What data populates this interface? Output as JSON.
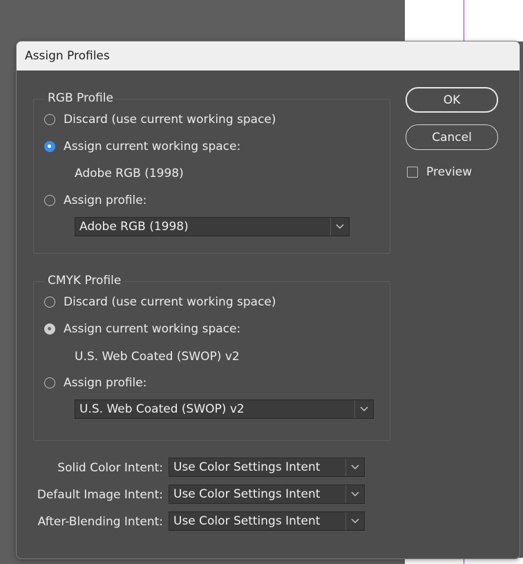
{
  "dialog": {
    "title": "Assign Profiles",
    "ok_label": "OK",
    "cancel_label": "Cancel",
    "preview_label": "Preview",
    "preview_checked": false
  },
  "rgb": {
    "legend": "RGB Profile",
    "discard_label": "Discard (use current working space)",
    "assign_current_label": "Assign current working space:",
    "current_space": "Adobe RGB (1998)",
    "assign_profile_label": "Assign profile:",
    "profile_selected": "Adobe RGB (1998)",
    "selected_option": "assign-current"
  },
  "cmyk": {
    "legend": "CMYK Profile",
    "discard_label": "Discard (use current working space)",
    "assign_current_label": "Assign current working space:",
    "current_space": "U.S. Web Coated (SWOP) v2",
    "assign_profile_label": "Assign profile:",
    "profile_selected": "U.S. Web Coated (SWOP) v2",
    "selected_option": "assign-current"
  },
  "intents": [
    {
      "label": "Solid Color Intent:",
      "value": "Use Color Settings Intent"
    },
    {
      "label": "Default Image Intent:",
      "value": "Use Color Settings Intent"
    },
    {
      "label": "After-Blending Intent:",
      "value": "Use Color Settings Intent"
    }
  ],
  "colors": {
    "accent": "#3b8ef0",
    "dialog_bg": "#4d4d4d",
    "titlebar_bg": "#efefef",
    "guide": "#9a2ad6"
  }
}
